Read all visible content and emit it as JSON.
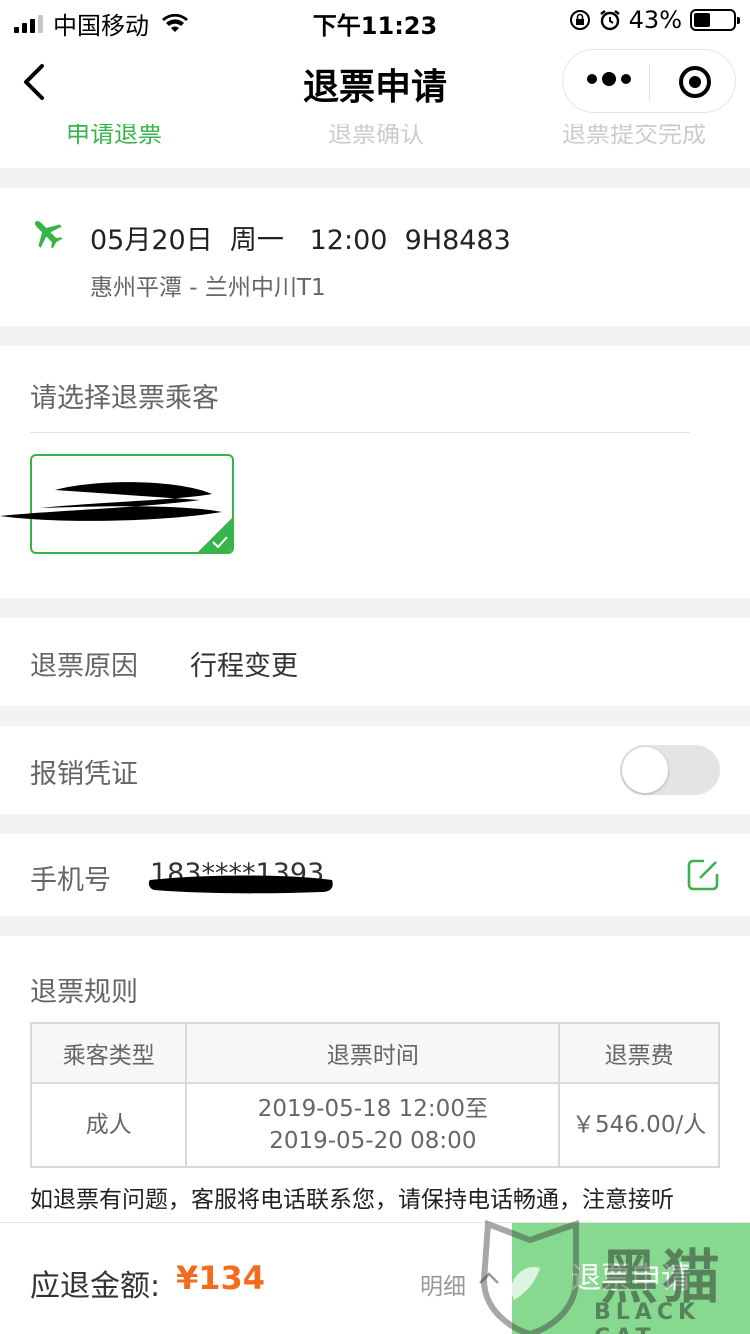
{
  "status_bar": {
    "carrier": "中国移动",
    "time": "下午11:23",
    "battery_percent": "43%",
    "battery_level": 0.43
  },
  "nav": {
    "title": "退票申请"
  },
  "steps": {
    "step1": "申请退票",
    "step2": "退票确认",
    "step3": "退票提交完成"
  },
  "flight": {
    "info": "05月20日  周一   12:00  9H8483",
    "route": "惠州平潭 - 兰州中川T1"
  },
  "passengers": {
    "label": "请选择退票乘客"
  },
  "reason": {
    "label": "退票原因",
    "value": "行程变更"
  },
  "invoice": {
    "label": "报销凭证",
    "enabled": false
  },
  "phone": {
    "label": "手机号",
    "value": "183****1393"
  },
  "rules": {
    "label": "退票规则",
    "headers": [
      "乘客类型",
      "退票时间",
      "退票费"
    ],
    "row": {
      "type": "成人",
      "time_line1": "2019-05-18 12:00至",
      "time_line2": "2019-05-20 08:00",
      "fee": "￥546.00/人"
    },
    "note": "如退票有问题，客服将电话联系您，请保持电话畅通，注意接听"
  },
  "footer": {
    "amount_label": "应退金额:",
    "amount": "¥134",
    "detail_label": "明细",
    "submit_label": "退票申请"
  },
  "watermark": {
    "text": "黑猫",
    "text_en": "BLACK CAT"
  },
  "colors": {
    "accent": "#38b54a",
    "price": "#f46b1e",
    "submit_bg": "#86d98f"
  }
}
